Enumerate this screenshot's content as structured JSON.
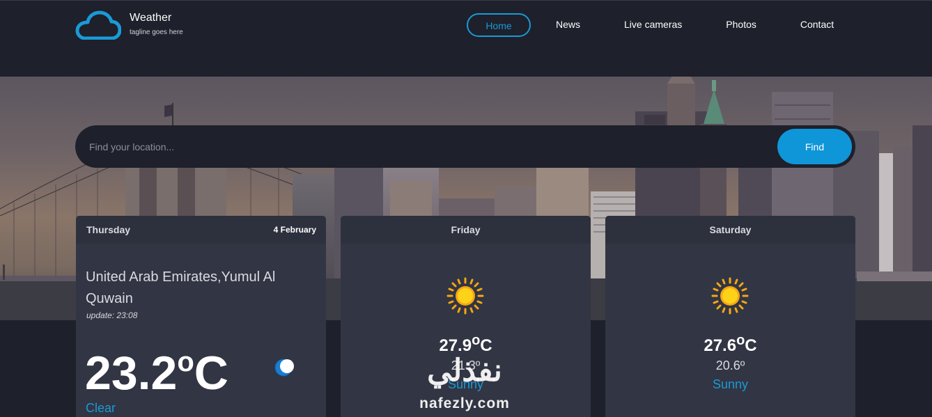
{
  "header": {
    "site_name": "Weather",
    "tagline": "tagline goes here",
    "nav": [
      {
        "label": "Home",
        "active": true
      },
      {
        "label": "News"
      },
      {
        "label": "Live cameras"
      },
      {
        "label": "Photos"
      },
      {
        "label": "Contact"
      }
    ]
  },
  "search": {
    "placeholder": "Find your location...",
    "button_label": "Find"
  },
  "today": {
    "day": "Thursday",
    "date": "4 February",
    "location": "United Arab Emirates,Yumul Al Quwain",
    "update": "update: 23:08",
    "temperature": "23.2",
    "unit_symbol": "o",
    "unit_letter": "C",
    "condition": "Clear",
    "icon": "moon-icon"
  },
  "forecast": [
    {
      "day": "Friday",
      "high": "27.9",
      "high_unit_symbol": "o",
      "high_unit_letter": "C",
      "low": "21.3º",
      "condition": "Sunny",
      "icon": "sun-icon"
    },
    {
      "day": "Saturday",
      "high": "27.6",
      "high_unit_symbol": "o",
      "high_unit_letter": "C",
      "low": "20.6º",
      "condition": "Sunny",
      "icon": "sun-icon"
    }
  ],
  "watermark": {
    "arabic": "نفذلي",
    "latin": "nafezly.com"
  },
  "colors": {
    "background": "#1e202b",
    "card": "#323543",
    "card_header": "#2d303d",
    "accent": "#1a9ad6",
    "button": "#0f96d8",
    "sun": "#f5c614"
  }
}
